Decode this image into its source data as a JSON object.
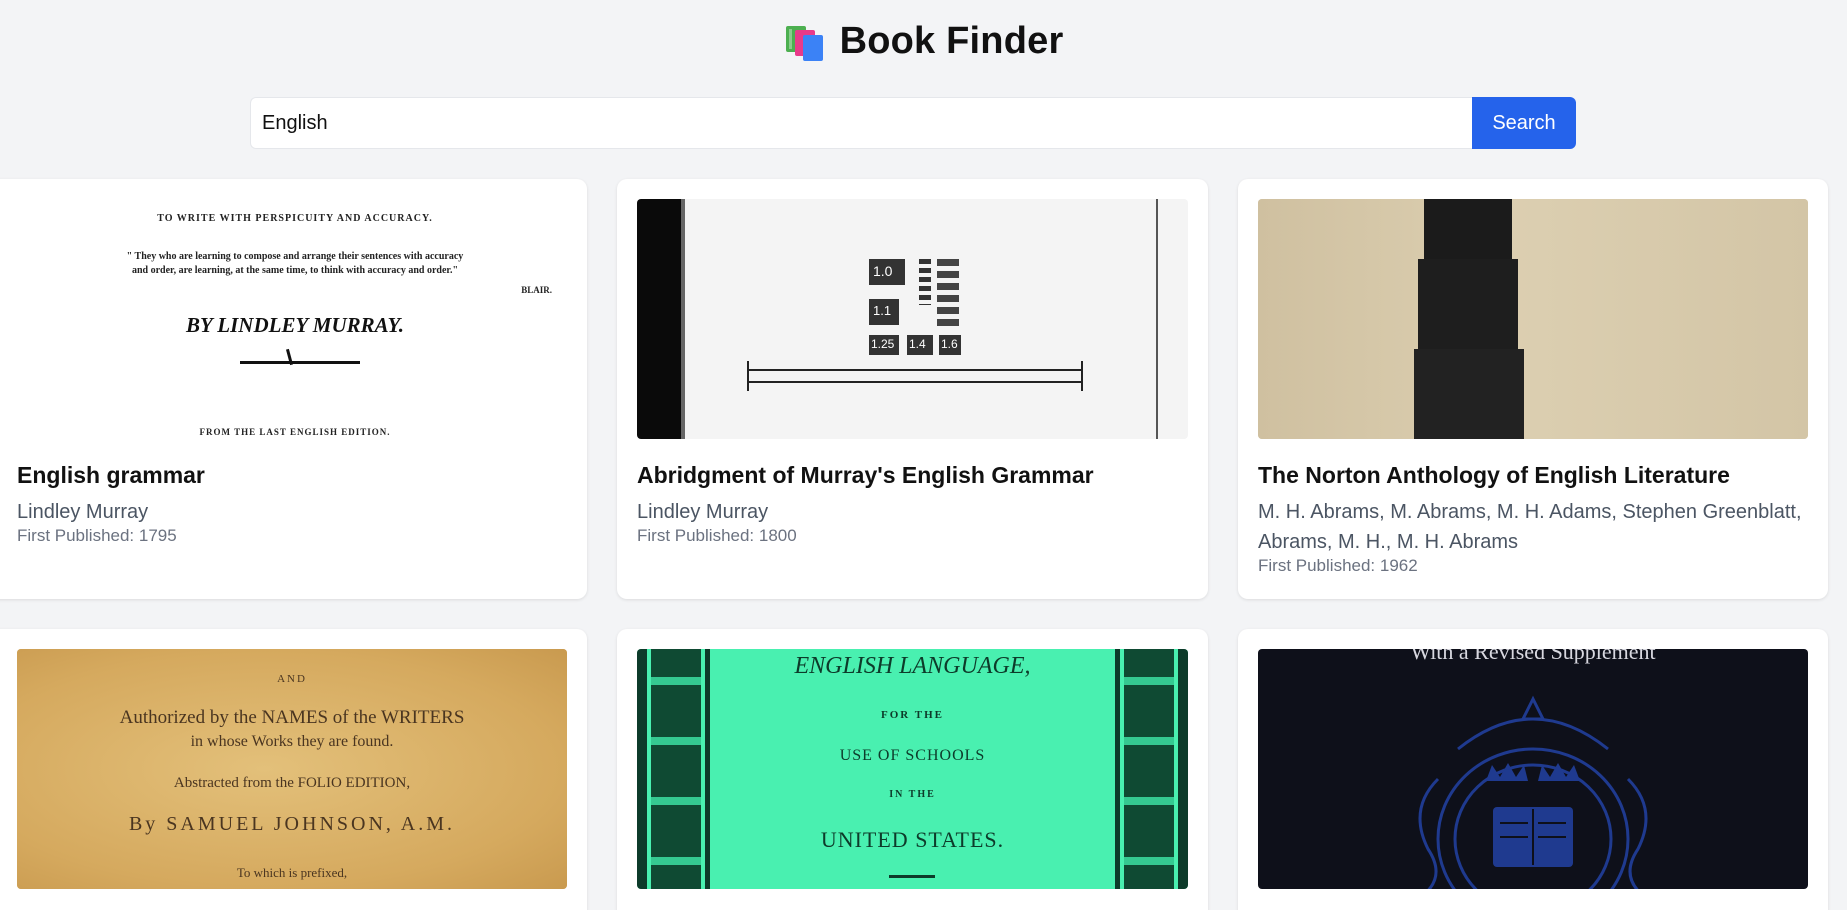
{
  "app": {
    "title": "Book Finder",
    "logo_icon": "books-icon"
  },
  "search": {
    "value": "English",
    "button_label": "Search"
  },
  "books": [
    {
      "title": "English grammar",
      "authors": "Lindley Murray",
      "published": "First Published: 1795",
      "cover": {
        "lines": [
          "TO WRITE WITH PERSPICUITY AND ACCURACY.",
          "\" They who are learning to compose and arrange their sentences with accuracy",
          "and order, are learning, at the same time, to think with accuracy and order.\"",
          "BLAIR.",
          "BY LINDLEY MURRAY.",
          "FROM THE LAST ENGLISH EDITION."
        ]
      }
    },
    {
      "title": "Abridgment of Murray's English Grammar",
      "authors": "Lindley Murray",
      "published": "First Published: 1800",
      "cover": {
        "lines": [
          "1.0",
          "1.1",
          "1.25",
          "1.4",
          "1.6"
        ]
      }
    },
    {
      "title": "The Norton Anthology of English Literature",
      "authors": "M. H. Abrams, M. Abrams, M. H. Adams, Stephen Greenblatt, Abrams, M. H., M. H. Abrams",
      "published": "First Published: 1962",
      "cover": {
        "lines": []
      }
    },
    {
      "title": "",
      "authors": "",
      "published": "",
      "cover": {
        "lines": [
          "AND",
          "Authorized by the NAMES of the WRITERS",
          "in whose Works they are found.",
          "Abstracted from the FOLIO EDITION,",
          "By SAMUEL JOHNSON, A.M.",
          "To which is prefixed,"
        ]
      }
    },
    {
      "title": "",
      "authors": "",
      "published": "",
      "cover": {
        "lines": [
          "ENGLISH LANGUAGE,",
          "FOR THE",
          "USE OF SCHOOLS",
          "IN THE",
          "UNITED STATES."
        ]
      }
    },
    {
      "title": "",
      "authors": "",
      "published": "",
      "cover": {
        "lines": [
          "With a Revised Supplement"
        ]
      }
    }
  ],
  "colors": {
    "accent": "#2563eb",
    "background": "#f3f4f6",
    "card": "#ffffff"
  }
}
